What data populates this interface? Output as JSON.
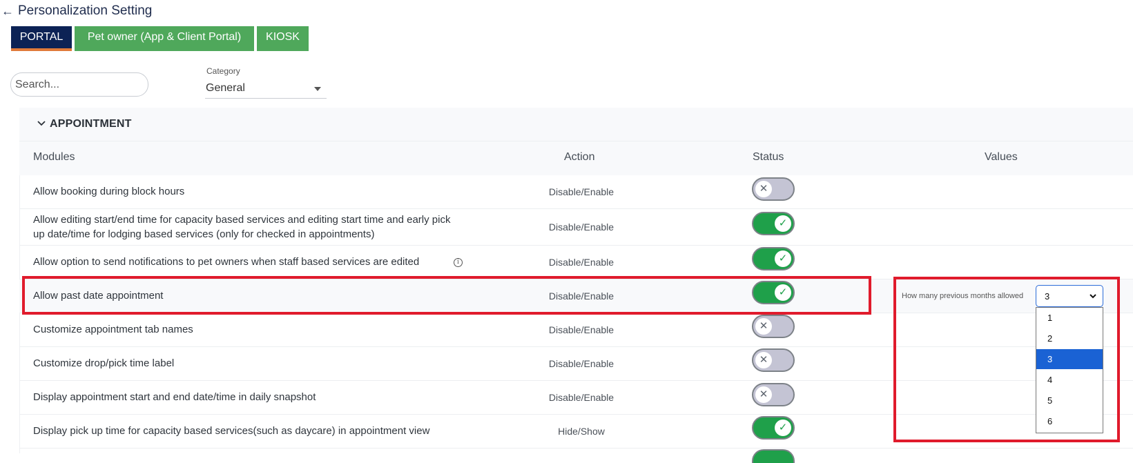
{
  "page": {
    "title": "Personalization Setting"
  },
  "tabs": [
    {
      "label": "PORTAL",
      "active": true
    },
    {
      "label": "Pet owner (App & Client Portal)",
      "active": false
    },
    {
      "label": "KIOSK",
      "active": false
    }
  ],
  "search": {
    "placeholder": "Search..."
  },
  "category": {
    "label": "Category",
    "value": "General"
  },
  "section": {
    "title": "APPOINTMENT"
  },
  "columns": {
    "modules": "Modules",
    "action": "Action",
    "status": "Status",
    "values": "Values"
  },
  "rows": [
    {
      "module": "Allow booking during block hours",
      "action": "Disable/Enable",
      "status": "off"
    },
    {
      "module_line1": "Allow editing start/end time for capacity based services and editing start time and early pick",
      "module_line2": "up date/time for lodging based services (only for checked in appointments)",
      "action": "Disable/Enable",
      "status": "on"
    },
    {
      "module": "Allow option to send notifications to pet owners when staff based services are edited",
      "action": "Disable/Enable",
      "status": "on",
      "info_icon": "info-icon"
    },
    {
      "module": "Allow past date appointment",
      "action": "Disable/Enable",
      "status": "on"
    },
    {
      "module": "Customize appointment tab names",
      "action": "Disable/Enable",
      "status": "off"
    },
    {
      "module": "Customize drop/pick time label",
      "action": "Disable/Enable",
      "status": "off"
    },
    {
      "module": "Display appointment start and end date/time in daily snapshot",
      "action": "Disable/Enable",
      "status": "off"
    },
    {
      "module": "Display pick up time for capacity based services(such as daycare) in appointment view",
      "action": "Hide/Show",
      "status": "on"
    }
  ],
  "past_date_value": {
    "label": "How many previous months allowed",
    "selected": "3",
    "options": [
      "1",
      "2",
      "3",
      "4",
      "5",
      "6"
    ]
  },
  "icons": {
    "toggle_on": "✓",
    "toggle_off": "✕",
    "info": "i",
    "back": "←"
  },
  "colors": {
    "navy": "#0c2255",
    "green_tab": "#4fa85b",
    "toggle_on": "#1fa04a",
    "highlight": "#e01b2c",
    "selected_option": "#1a62d4"
  }
}
